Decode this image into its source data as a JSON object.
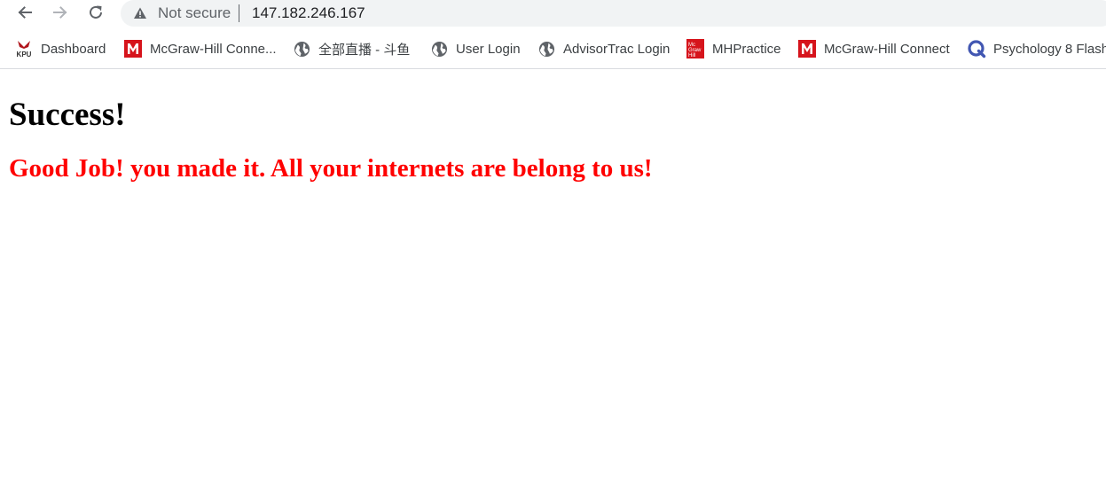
{
  "address_bar": {
    "security_status": "Not secure",
    "url": "147.182.246.167"
  },
  "bookmarks": [
    {
      "label": "Dashboard",
      "icon": "kpu-logo-icon"
    },
    {
      "label": "McGraw-Hill Conne...",
      "icon": "mcgraw-hill-m-icon"
    },
    {
      "label": "全部直播 - 斗鱼",
      "icon": "globe-icon"
    },
    {
      "label": "User Login",
      "icon": "globe-icon"
    },
    {
      "label": "AdvisorTrac Login",
      "icon": "globe-icon"
    },
    {
      "label": "MHPractice",
      "icon": "mcgraw-hill-book-icon"
    },
    {
      "label": "McGraw-Hill Connect",
      "icon": "mcgraw-hill-m-icon"
    },
    {
      "label": "Psychology 8 Flashc",
      "icon": "quizlet-q-icon"
    }
  ],
  "page": {
    "heading": "Success!",
    "message": "Good Job! you made it. All your internets are belong to us!"
  },
  "colors": {
    "message": "#ff0000",
    "heading": "#000000",
    "omnibox_bg": "#f1f3f4",
    "mcgraw_red": "#d6141c",
    "quizlet_blue": "#4257b2"
  }
}
